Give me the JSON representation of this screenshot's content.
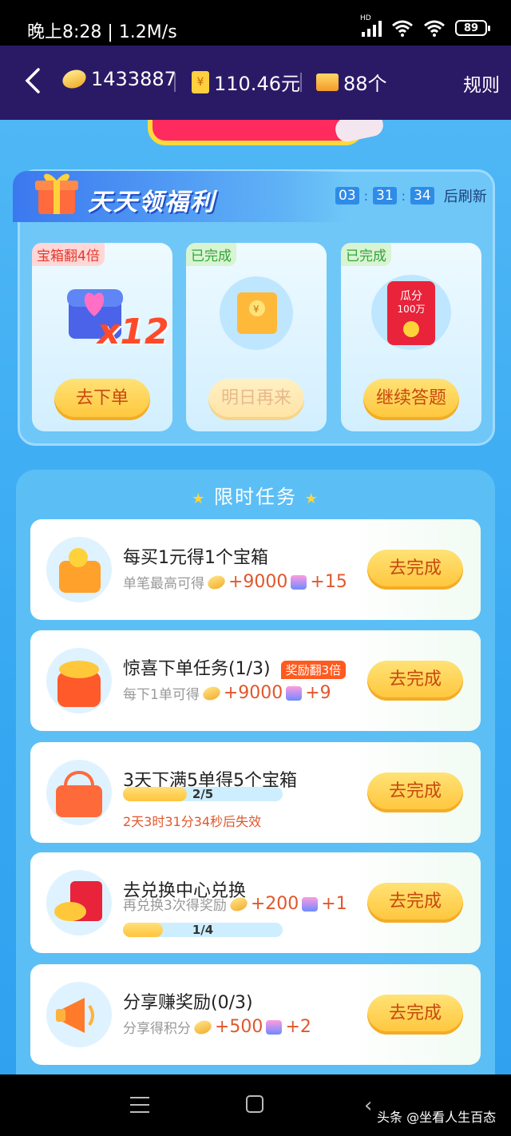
{
  "status_bar": {
    "time": "晚上8:28",
    "speed": "1.2M/s",
    "signal_label": "HD",
    "battery": "89"
  },
  "header": {
    "coins": "1433887",
    "money": "110.46元",
    "boxes": "88个",
    "rules": "规则"
  },
  "welfare": {
    "title": "天天领福利",
    "timer": {
      "h": "03",
      "m": "31",
      "s": "34",
      "suffix": "后刷新"
    },
    "cards": [
      {
        "tag": "宝箱翻4倍",
        "multiplier": "x12",
        "button": "去下单"
      },
      {
        "tag": "已完成",
        "button": "明日再来"
      },
      {
        "tag": "已完成",
        "art_text_1": "瓜分",
        "art_text_2": "100万",
        "button": "继续答题"
      }
    ]
  },
  "tasks_section": {
    "title": "限时任务",
    "items": [
      {
        "name": "每买1元得1个宝箱",
        "sub": "单笔最高可得",
        "coins": "+9000",
        "gems": "+15",
        "button": "去完成"
      },
      {
        "name": "惊喜下单任务(1/3)",
        "badge": "奖励翻3倍",
        "sub": "每下1单可得",
        "coins": "+9000",
        "gems": "+9",
        "button": "去完成"
      },
      {
        "name": "3天下满5单得5个宝箱",
        "progress_text": "2/5",
        "progress": 0.4,
        "expire": "2天3时31分34秒后失效",
        "button": "去完成"
      },
      {
        "name": "去兑换中心兑换",
        "sub": "再兑换3次得奖励",
        "coins": "+200",
        "gems": "+1",
        "progress_text": "1/4",
        "progress": 0.25,
        "button": "去完成"
      },
      {
        "name": "分享赚奖励(0/3)",
        "sub": "分享得积分",
        "coins": "+500",
        "gems": "+2",
        "button": "去完成"
      }
    ]
  },
  "nav": {
    "watermark": "头条 @坐看人生百态"
  }
}
